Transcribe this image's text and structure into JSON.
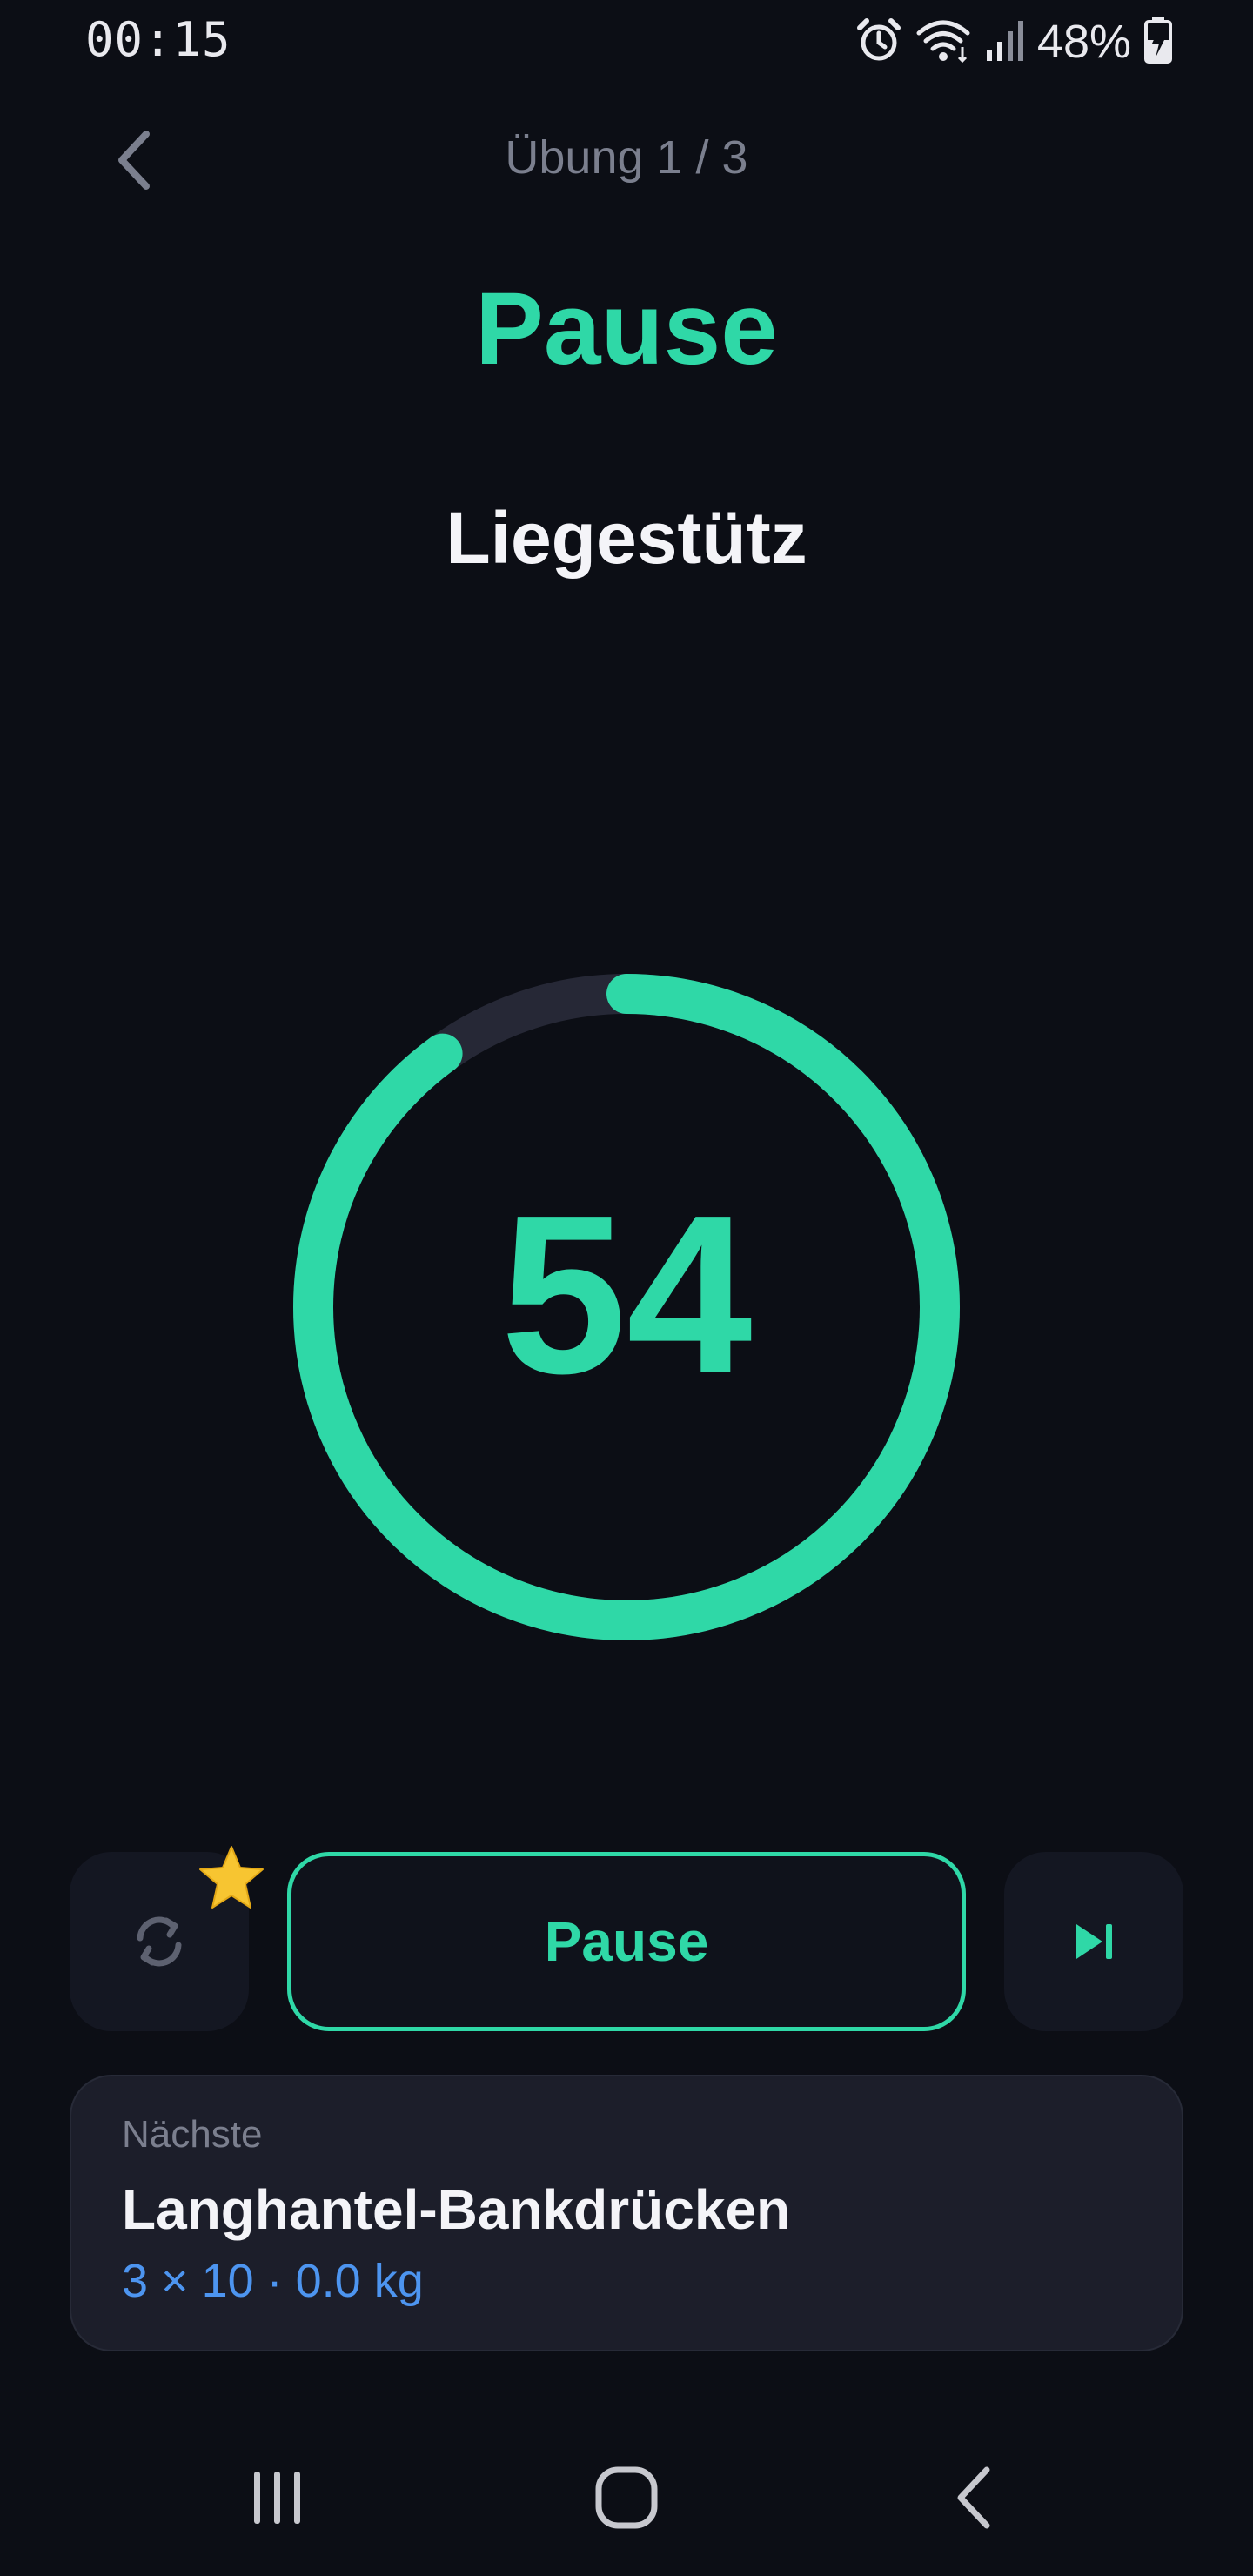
{
  "status_bar": {
    "time": "00:15",
    "battery_percent": "48%",
    "icons": [
      "alarm-icon",
      "wifi-icon",
      "signal-icon",
      "battery-charging-icon"
    ]
  },
  "header": {
    "title": "Übung 1 / 3"
  },
  "phase": {
    "title": "Pause"
  },
  "exercise": {
    "name": "Liegestütz"
  },
  "timer": {
    "value": "54",
    "progress_fraction": 0.9,
    "ring_color": "#2fd8a7",
    "track_color": "#262836"
  },
  "controls": {
    "repeat_icon": "repeat-icon",
    "star_icon": "star-icon",
    "pause_label": "Pause",
    "skip_icon": "skip-next-icon"
  },
  "next": {
    "label": "Nächste",
    "exercise": "Langhantel-Bankdrücken",
    "detail": "3 × 10 · 0.0 kg"
  },
  "nav": {
    "items": [
      "recents-icon",
      "home-icon",
      "back-icon"
    ]
  },
  "colors": {
    "background": "#0c0e15",
    "accent": "#2fd8a7",
    "muted": "#7b7f8e",
    "link": "#4d95f0",
    "card": "#1c1e2a"
  }
}
